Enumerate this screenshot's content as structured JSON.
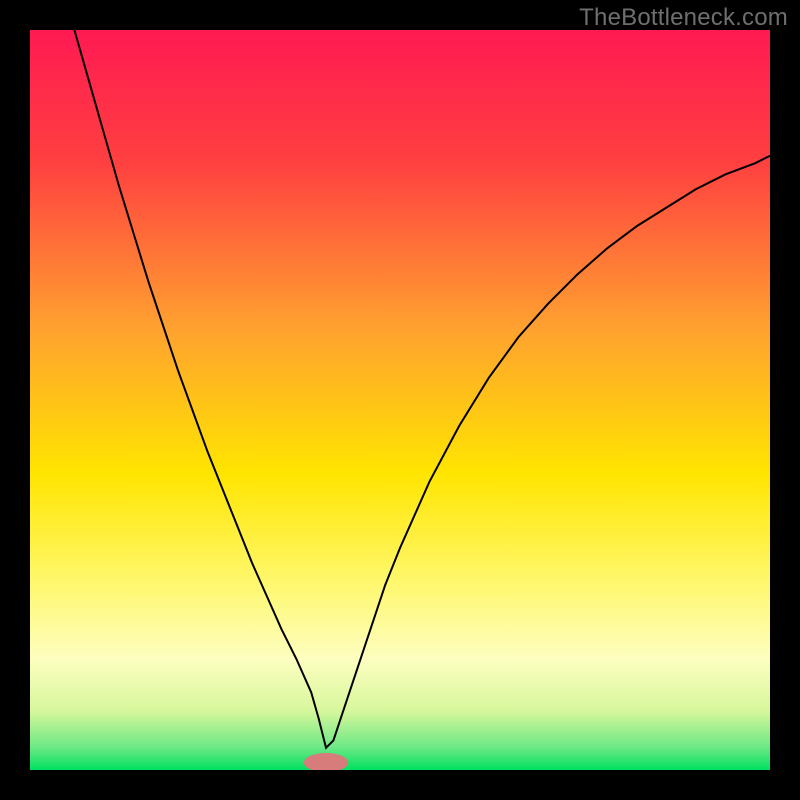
{
  "watermark": "TheBottleneck.com",
  "chart_data": {
    "type": "line",
    "title": "",
    "xlabel": "",
    "ylabel": "",
    "xlim": [
      0,
      100
    ],
    "ylim": [
      0,
      100
    ],
    "grid": false,
    "legend": false,
    "gradient_stops": [
      {
        "offset": 0,
        "color": "#ff1a52"
      },
      {
        "offset": 18,
        "color": "#ff4040"
      },
      {
        "offset": 40,
        "color": "#ffa030"
      },
      {
        "offset": 60,
        "color": "#ffe500"
      },
      {
        "offset": 75,
        "color": "#fff870"
      },
      {
        "offset": 85,
        "color": "#fdfec0"
      },
      {
        "offset": 92,
        "color": "#d7f79c"
      },
      {
        "offset": 97,
        "color": "#6be885"
      },
      {
        "offset": 100,
        "color": "#00e060"
      }
    ],
    "minimum_marker": {
      "x": 40,
      "y": 1,
      "color": "#d77b7b",
      "rx": 3,
      "ry": 1.3
    },
    "series": [
      {
        "name": "curve",
        "x": [
          6,
          8,
          10,
          12,
          14,
          16,
          18,
          20,
          22,
          24,
          26,
          28,
          30,
          32,
          34,
          36,
          38,
          39,
          40,
          41,
          42,
          44,
          46,
          48,
          50,
          54,
          58,
          62,
          66,
          70,
          74,
          78,
          82,
          86,
          90,
          94,
          98,
          100
        ],
        "y": [
          100,
          93,
          86,
          79,
          72.5,
          66,
          60,
          54,
          48.5,
          43,
          38,
          33,
          28,
          23.5,
          19,
          15,
          10.5,
          7,
          3,
          4,
          7,
          13,
          19,
          25,
          30,
          39,
          46.5,
          53,
          58.5,
          63,
          67,
          70.5,
          73.5,
          76,
          78.5,
          80.5,
          82,
          83
        ]
      }
    ]
  }
}
